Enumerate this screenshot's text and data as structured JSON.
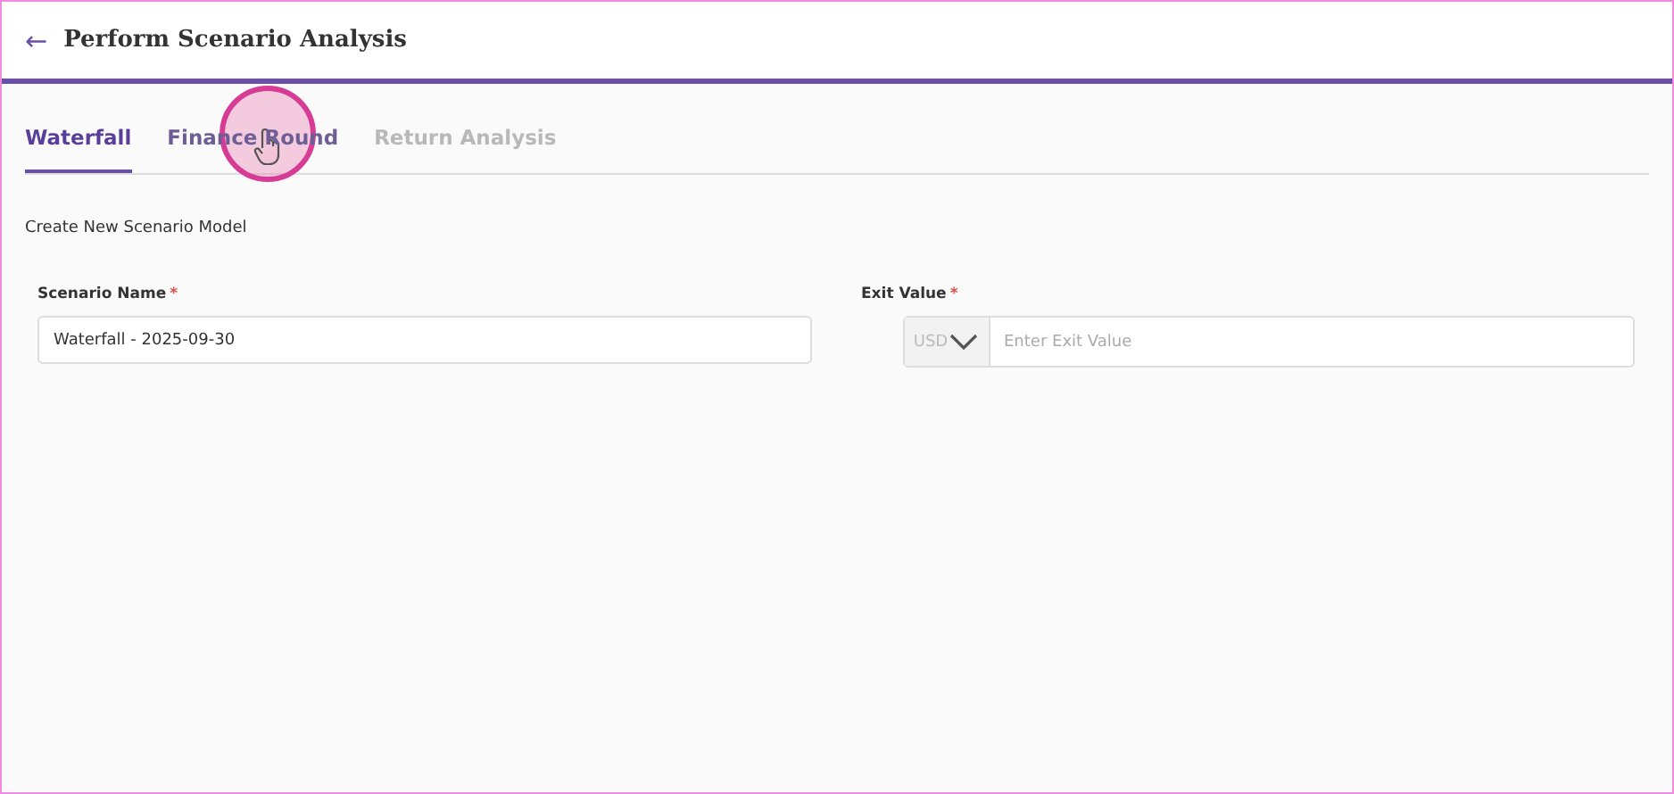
{
  "header": {
    "back_icon": "←",
    "title": "Perform Scenario Analysis"
  },
  "tabs": [
    {
      "label": "Waterfall",
      "selected": true,
      "disabled": false
    },
    {
      "label": "Finance Round",
      "selected": false,
      "disabled": false
    },
    {
      "label": "Return Analysis",
      "selected": false,
      "disabled": true
    }
  ],
  "cursor": {
    "kind": "click"
  },
  "section_title": "Create New Scenario Model",
  "fields": [
    {
      "kind": "text",
      "label": "Scenario Name",
      "required_mark": "*",
      "value": "Waterfall - 2025-09-30"
    },
    {
      "kind": "currency",
      "label": "Exit Value",
      "required_mark": "*",
      "currency": "USD",
      "placeholder": "Enter Exit Value"
    }
  ]
}
